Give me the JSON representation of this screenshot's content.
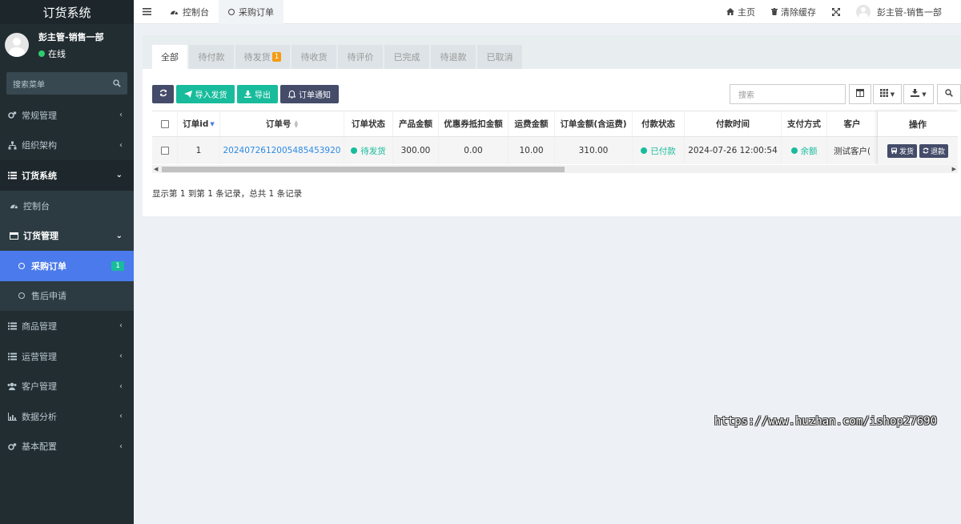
{
  "sidebar": {
    "brand": "订货系统",
    "user": {
      "name": "彭主管-销售一部",
      "status": "在线"
    },
    "search_placeholder": "搜索菜单",
    "menu": [
      {
        "label": "常规管理",
        "icon": "cogs-icon",
        "state": "collapsed"
      },
      {
        "label": "组织架构",
        "icon": "sitemap-icon",
        "state": "collapsed"
      },
      {
        "label": "订货系统",
        "icon": "list-icon",
        "state": "open"
      },
      {
        "label": "控制台",
        "icon": "dashboard-icon",
        "state": "sub"
      },
      {
        "label": "订货管理",
        "icon": "table-icon",
        "state": "sub-open"
      },
      {
        "label": "采购订单",
        "icon": "circle-icon",
        "state": "active",
        "badge": "1"
      },
      {
        "label": "售后申请",
        "icon": "circle-icon",
        "state": "subsub"
      },
      {
        "label": "商品管理",
        "icon": "list-icon",
        "state": "collapsed"
      },
      {
        "label": "运营管理",
        "icon": "list-icon",
        "state": "collapsed"
      },
      {
        "label": "客户管理",
        "icon": "users-icon",
        "state": "collapsed"
      },
      {
        "label": "数据分析",
        "icon": "bar-chart-icon",
        "state": "collapsed"
      },
      {
        "label": "基本配置",
        "icon": "cogs-icon",
        "state": "collapsed"
      }
    ]
  },
  "topbar": {
    "tabs": [
      {
        "label": "控制台",
        "icon": "dashboard-icon"
      },
      {
        "label": "采购订单",
        "icon": "circle-icon"
      }
    ],
    "home": "主页",
    "clear_cache": "清除缓存",
    "user": "彭主管-销售一部"
  },
  "order_tabs": [
    {
      "label": "全部"
    },
    {
      "label": "待付款"
    },
    {
      "label": "待发货",
      "badge": "1"
    },
    {
      "label": "待收货"
    },
    {
      "label": "待评价"
    },
    {
      "label": "已完成"
    },
    {
      "label": "待退款"
    },
    {
      "label": "已取消"
    }
  ],
  "toolbar": {
    "import_ship": "导入发货",
    "export": "导出",
    "order_notify": "订单通知",
    "search_placeholder": "搜索"
  },
  "table": {
    "headers": [
      "订单id",
      "订单号",
      "订单状态",
      "产品金额",
      "优惠券抵扣金额",
      "运费金额",
      "订单金额(含运费)",
      "付款状态",
      "付款时间",
      "支付方式",
      "客户",
      "操作"
    ],
    "rows": [
      {
        "id": "1",
        "order_no": "2024072612005485453920",
        "order_status": "待发货",
        "product_amount": "300.00",
        "coupon_discount": "0.00",
        "shipping_fee": "10.00",
        "order_total": "310.00",
        "pay_status": "已付款",
        "pay_time": "2024-07-26 12:00:54",
        "pay_method": "余额",
        "customer": "测试客户(",
        "ship_btn": "发货",
        "refund_btn": "退款"
      }
    ]
  },
  "pagination": "显示第 1 到第 1 条记录，总共 1 条记录",
  "watermark": "https://www.huzhan.com/ishop27690",
  "colors": {
    "sidebar_bg": "#222d32",
    "active_menu": "#4a7aeb",
    "green": "#18bc9c",
    "dark_btn": "#444c69",
    "orange_badge": "#f39c12",
    "link": "#2c8ae6"
  }
}
